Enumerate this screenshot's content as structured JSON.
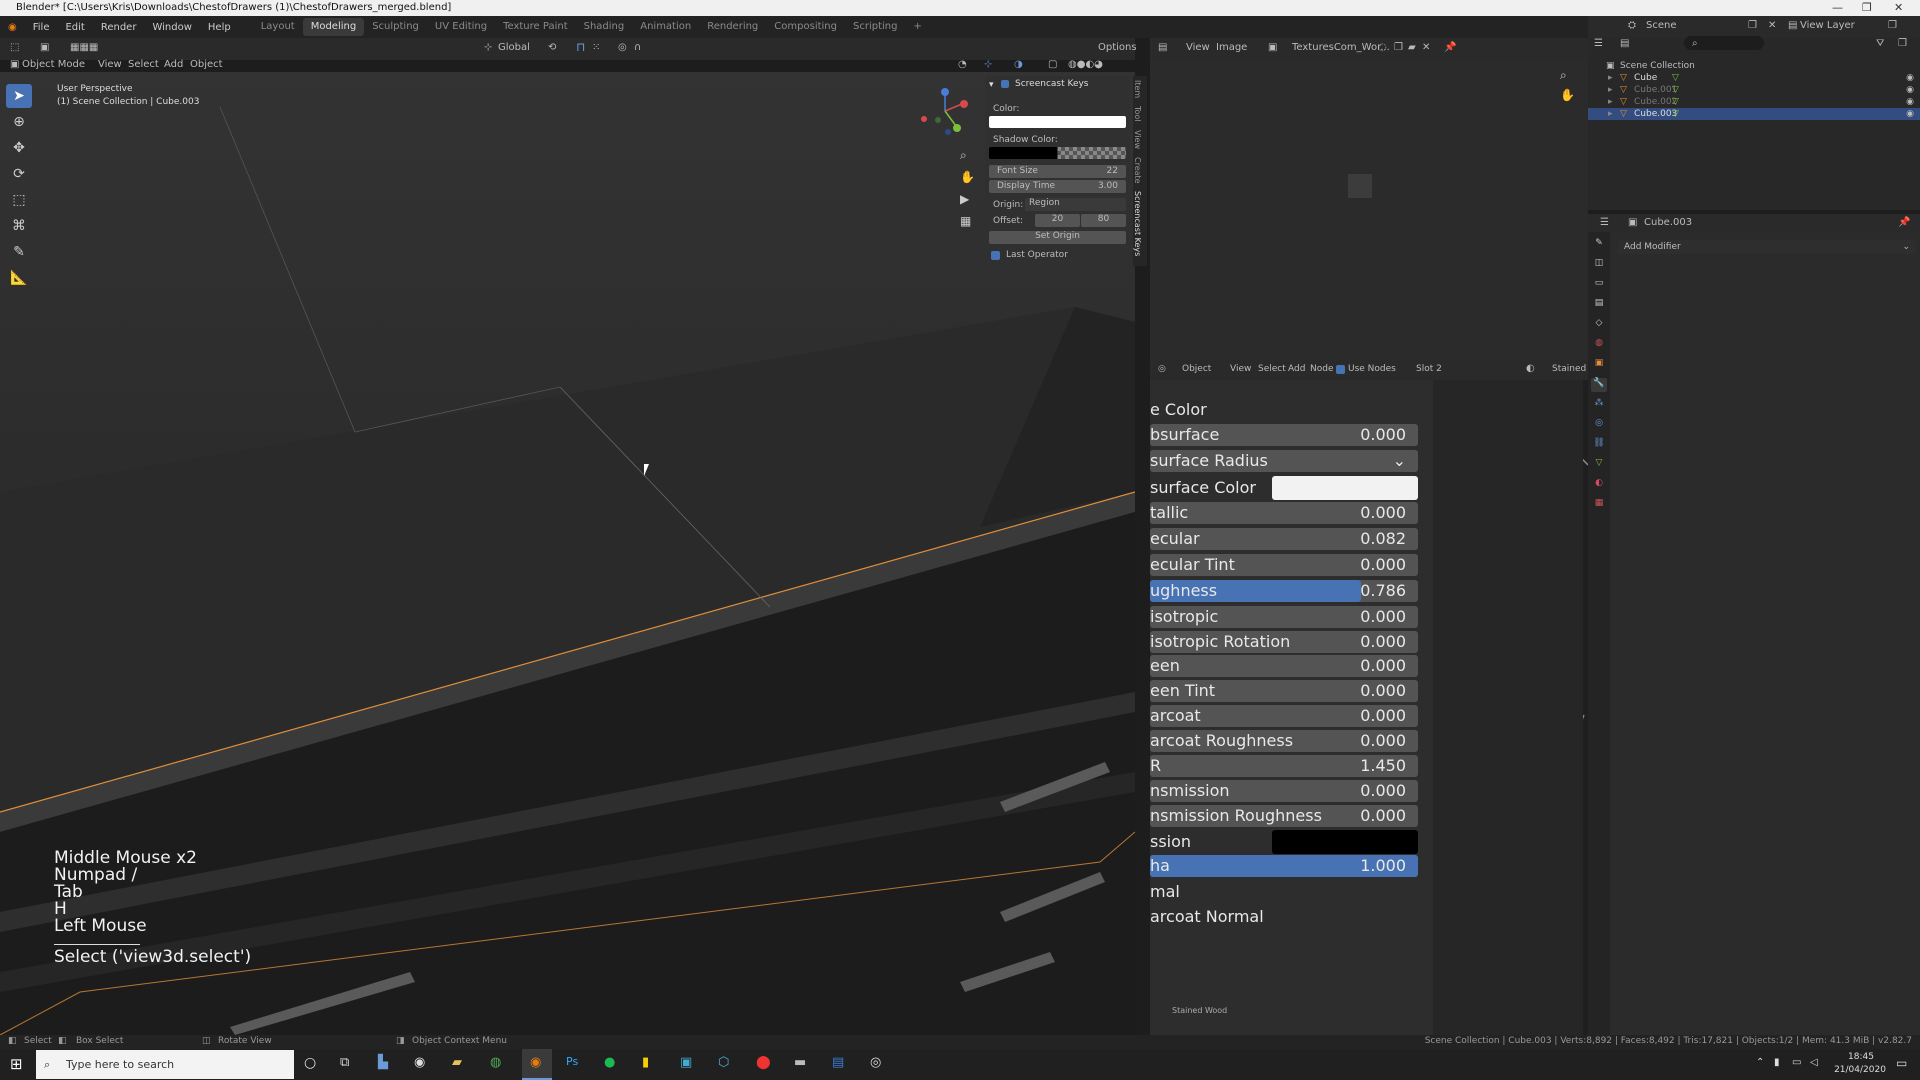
{
  "title": "Blender* [C:\\Users\\Kris\\Downloads\\ChestofDrawers (1)\\ChestofDrawers_merged.blend]",
  "menu": [
    "File",
    "Edit",
    "Render",
    "Window",
    "Help"
  ],
  "workspaces": [
    "Layout",
    "Modeling",
    "Sculpting",
    "UV Editing",
    "Texture Paint",
    "Shading",
    "Animation",
    "Rendering",
    "Compositing",
    "Scripting"
  ],
  "active_workspace": "Modeling",
  "scene": "Scene",
  "view_layer": "View Layer",
  "viewport": {
    "mode": "Object Mode",
    "menus": [
      "View",
      "Select",
      "Add",
      "Object"
    ],
    "transform": "Global",
    "options": "Options",
    "overlay_line1": "User Perspective",
    "overlay_line2": "(1) Scene Collection | Cube.003"
  },
  "screencast": {
    "panel_title": "Screencast Keys",
    "color_label": "Color:",
    "shadow_label": "Shadow Color:",
    "font_size_label": "Font Size",
    "font_size": "22",
    "display_time_label": "Display Time",
    "display_time": "3.00",
    "origin_label": "Origin:",
    "origin_value": "Region",
    "offset_label": "Offset:",
    "offset_x": "20",
    "offset_y": "80",
    "set_origin": "Set Origin",
    "last_operator": "Last Operator",
    "keys": [
      "Middle Mouse x2",
      "Numpad /",
      "Tab",
      "H",
      "Left Mouse"
    ],
    "operator": "Select ('view3d.select')"
  },
  "ntabs": [
    "Item",
    "Tool",
    "View",
    "Create",
    "Screencast Keys"
  ],
  "image_editor": {
    "menus": [
      "View",
      "Image"
    ],
    "image_name": "TexturesCom_Wor..."
  },
  "node_editor": {
    "object_mode": "Object",
    "menus": [
      "View",
      "Select",
      "Add",
      "Node"
    ],
    "use_nodes": "Use Nodes",
    "slot": "Slot 2",
    "material": "Stained",
    "frame_label": "Stained Wood"
  },
  "bsdf": {
    "partial_top": "...rsurface Color",
    "rows": [
      {
        "label": "e Color",
        "type": "label"
      },
      {
        "label": "bsurface",
        "value": "0.000",
        "type": "value"
      },
      {
        "label": "surface Radius",
        "type": "dropdown"
      },
      {
        "label": "surface Color",
        "type": "color",
        "color": "#f2f2f2"
      },
      {
        "label": "tallic",
        "value": "0.000",
        "type": "value"
      },
      {
        "label": "ecular",
        "value": "0.082",
        "type": "value"
      },
      {
        "label": "ecular Tint",
        "value": "0.000",
        "type": "value"
      },
      {
        "label": "ughness",
        "value": "0.786",
        "type": "slider",
        "fraction": 0.786
      },
      {
        "label": "isotropic",
        "value": "0.000",
        "type": "value"
      },
      {
        "label": "isotropic Rotation",
        "value": "0.000",
        "type": "value"
      },
      {
        "label": "een",
        "value": "0.000",
        "type": "value"
      },
      {
        "label": "een Tint",
        "value": "0.000",
        "type": "value"
      },
      {
        "label": "arcoat",
        "value": "0.000",
        "type": "value"
      },
      {
        "label": "arcoat Roughness",
        "value": "0.000",
        "type": "value"
      },
      {
        "label": "R",
        "value": "1.450",
        "type": "value"
      },
      {
        "label": "nsmission",
        "value": "0.000",
        "type": "value"
      },
      {
        "label": "nsmission Roughness",
        "value": "0.000",
        "type": "value"
      },
      {
        "label": "ssion",
        "type": "color",
        "color": "#000000"
      },
      {
        "label": "ha",
        "value": "1.000",
        "type": "slider",
        "fraction": 1.0
      },
      {
        "label": "mal",
        "type": "label"
      },
      {
        "label": "arcoat Normal",
        "type": "label"
      }
    ]
  },
  "outliner": {
    "root": "Scene Collection",
    "items": [
      "Cube",
      "Cube.001",
      "Cube.002",
      "Cube.003"
    ],
    "selected": "Cube.003"
  },
  "properties": {
    "object": "Cube.003",
    "add_modifier": "Add Modifier"
  },
  "status": {
    "select": "Select",
    "box_select": "Box Select",
    "rotate_view": "Rotate View",
    "context_menu": "Object Context Menu",
    "stats": "Scene Collection | Cube.003 | Verts:8,892 | Faces:8,492 | Tris:17,821 | Objects:1/2 | Mem: 41.3 MiB | v2.82.7"
  },
  "taskbar": {
    "search_placeholder": "Type here to search",
    "time": "18:45",
    "date": "21/04/2020"
  },
  "colors": {
    "accent": "#4772b3",
    "selection": "#e08d3c"
  }
}
